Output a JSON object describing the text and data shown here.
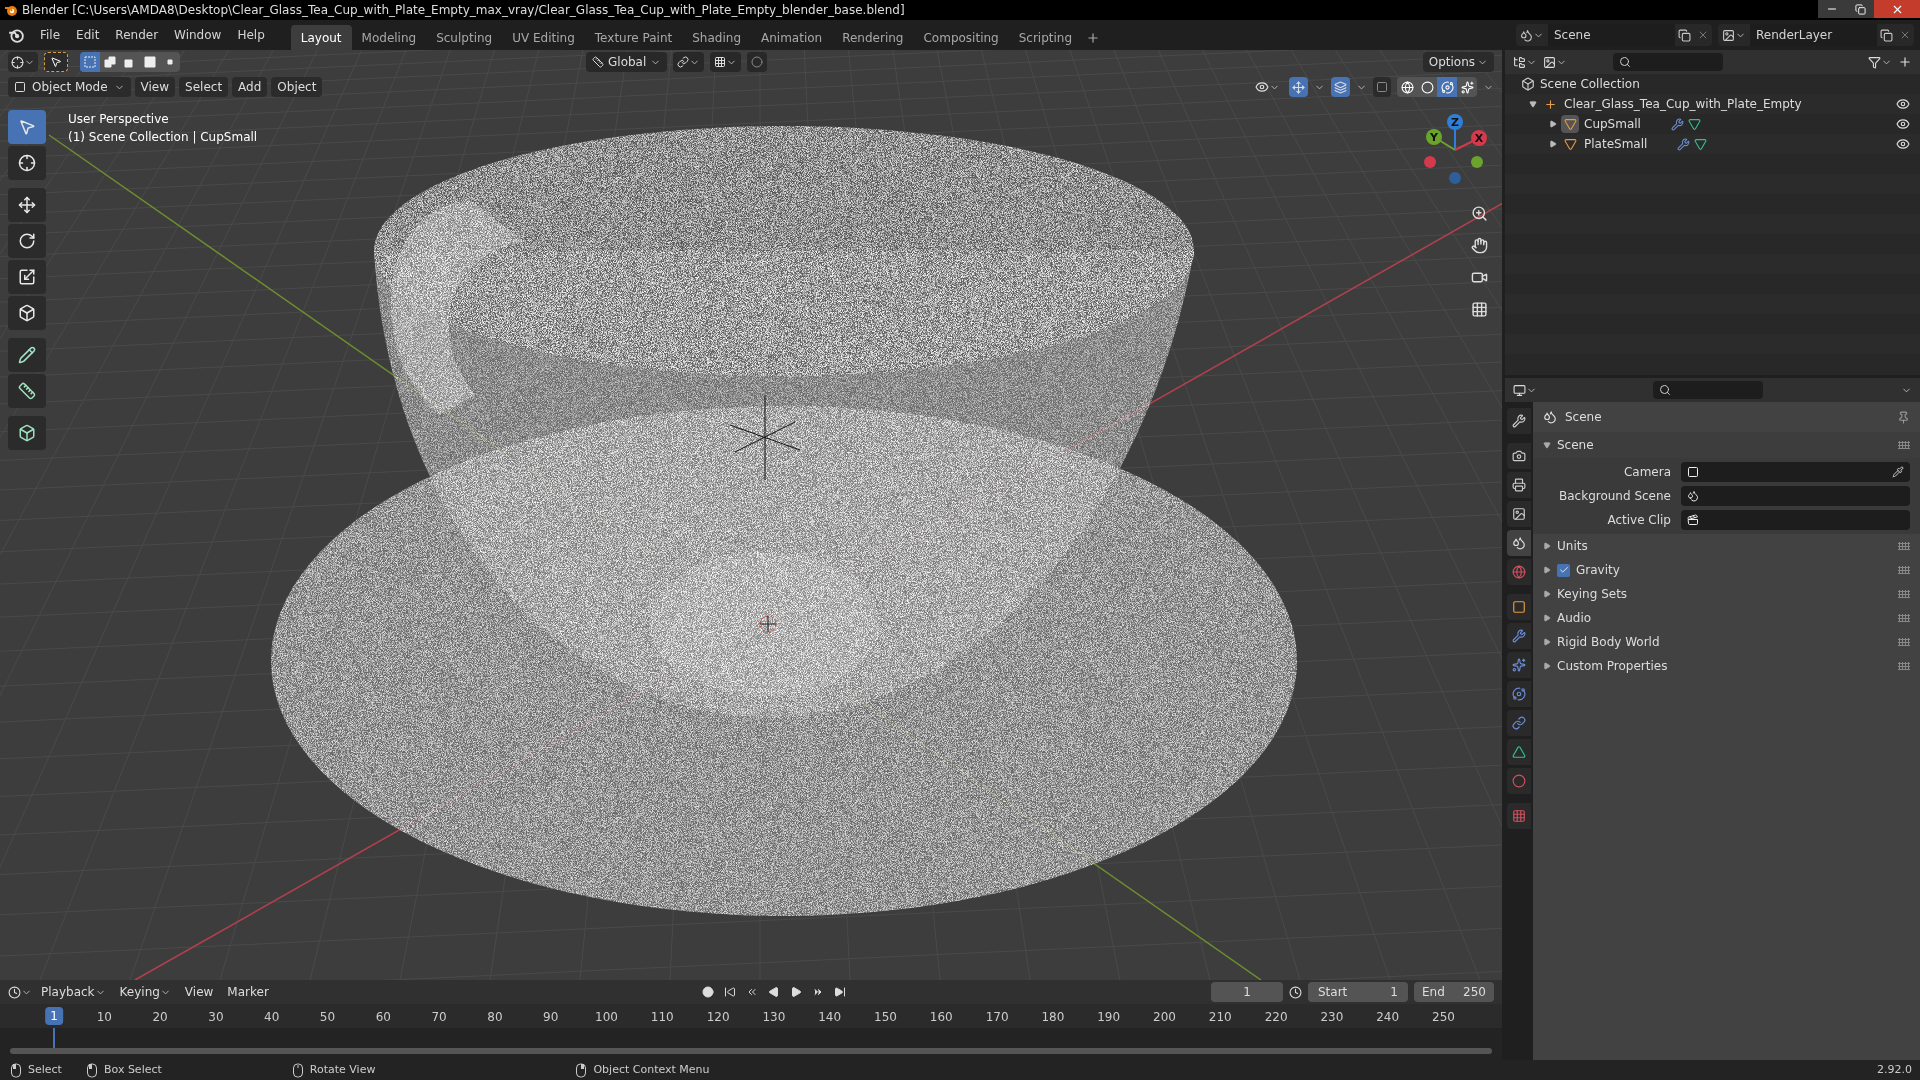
{
  "window": {
    "title": "Blender [C:\\Users\\AMDA8\\Desktop\\Clear_Glass_Tea_Cup_with_Plate_Empty_max_vray/Clear_Glass_Tea_Cup_with_Plate_Empty_blender_base.blend]"
  },
  "menu": [
    "File",
    "Edit",
    "Render",
    "Window",
    "Help"
  ],
  "workspaces": [
    {
      "label": "Layout",
      "selected": true
    },
    {
      "label": "Modeling",
      "selected": false
    },
    {
      "label": "Sculpting",
      "selected": false
    },
    {
      "label": "UV Editing",
      "selected": false
    },
    {
      "label": "Texture Paint",
      "selected": false
    },
    {
      "label": "Shading",
      "selected": false
    },
    {
      "label": "Animation",
      "selected": false
    },
    {
      "label": "Rendering",
      "selected": false
    },
    {
      "label": "Compositing",
      "selected": false
    },
    {
      "label": "Scripting",
      "selected": false
    }
  ],
  "scene_selector": {
    "value": "Scene"
  },
  "view_layer_selector": {
    "value": "RenderLayer"
  },
  "tool_header": {
    "select_modes": [
      {
        "kind": "set",
        "selected": true
      },
      {
        "kind": "extend",
        "selected": false
      },
      {
        "kind": "subtract",
        "selected": false
      },
      {
        "kind": "invert",
        "selected": false
      },
      {
        "kind": "intersect",
        "selected": false
      }
    ],
    "orientation": "Global",
    "options": "Options"
  },
  "viewport_header": {
    "mode": "Object Mode",
    "menus": [
      "View",
      "Select",
      "Add",
      "Object"
    ],
    "shading": [
      {
        "kind": "wireframe",
        "selected": false
      },
      {
        "kind": "solid",
        "selected": false
      },
      {
        "kind": "material",
        "selected": true
      },
      {
        "kind": "rendered",
        "selected": false
      }
    ]
  },
  "viewport": {
    "info": [
      "User Perspective",
      "(1) Scene Collection | CupSmall"
    ],
    "gizmo_axes": [
      {
        "label": "Z",
        "color": "#2f7fd8"
      },
      {
        "label": "Y",
        "color": "#6ba42a"
      },
      {
        "label": "X",
        "color": "#d5394c"
      }
    ]
  },
  "toolbar": [
    {
      "kind": "select",
      "selected": true
    },
    {
      "kind": "cursor",
      "selected": false
    },
    {
      "kind": "move",
      "selected": false
    },
    {
      "kind": "rotate",
      "selected": false
    },
    {
      "kind": "scale",
      "selected": false
    },
    {
      "kind": "transform",
      "selected": false
    },
    {
      "kind": "annotate",
      "selected": false
    },
    {
      "kind": "measure",
      "selected": false
    },
    {
      "kind": "add-cube",
      "selected": false
    }
  ],
  "outliner": {
    "root": "Scene Collection",
    "items": [
      {
        "label": "Clear_Glass_Tea_Cup_with_Plate_Empty",
        "kind": "empty",
        "expanded": true,
        "children": [
          {
            "label": "CupSmall",
            "kind": "mesh",
            "expanded": false,
            "active": true
          },
          {
            "label": "PlateSmall",
            "kind": "mesh",
            "expanded": false,
            "active": false
          }
        ]
      }
    ]
  },
  "properties": {
    "tabs": [
      {
        "kind": "tool",
        "selected": false
      },
      {
        "kind": "render",
        "selected": false
      },
      {
        "kind": "output",
        "selected": false
      },
      {
        "kind": "view-layer",
        "selected": false
      },
      {
        "kind": "scene",
        "selected": true
      },
      {
        "kind": "world",
        "selected": false
      },
      {
        "kind": "object",
        "selected": false
      },
      {
        "kind": "modifiers",
        "selected": false
      },
      {
        "kind": "particles",
        "selected": false
      },
      {
        "kind": "physics",
        "selected": false
      },
      {
        "kind": "constraints",
        "selected": false
      },
      {
        "kind": "data",
        "selected": false
      },
      {
        "kind": "material",
        "selected": false
      },
      {
        "kind": "texture",
        "selected": false
      }
    ],
    "context": "Scene",
    "panel": {
      "title": "Scene",
      "expanded": true,
      "fields": [
        {
          "label": "Camera",
          "kind": "camera"
        },
        {
          "label": "Background Scene",
          "kind": "scene"
        },
        {
          "label": "Active Clip",
          "kind": "clip"
        }
      ]
    },
    "subpanels": [
      {
        "label": "Units",
        "expanded": false
      },
      {
        "label": "Gravity",
        "expanded": false,
        "checked": true
      },
      {
        "label": "Keying Sets",
        "expanded": false
      },
      {
        "label": "Audio",
        "expanded": false
      },
      {
        "label": "Rigid Body World",
        "expanded": false
      },
      {
        "label": "Custom Properties",
        "expanded": false
      }
    ]
  },
  "timeline": {
    "menus": [
      {
        "label": "Playback",
        "dropdown": true
      },
      {
        "label": "Keying",
        "dropdown": true
      },
      {
        "label": "View",
        "dropdown": false
      },
      {
        "label": "Marker",
        "dropdown": false
      }
    ],
    "current_frame": "1",
    "start": {
      "label": "Start",
      "value": "1"
    },
    "end": {
      "label": "End",
      "value": "250"
    },
    "playhead": "1",
    "ticks": [
      "10",
      "20",
      "30",
      "40",
      "50",
      "60",
      "70",
      "80",
      "90",
      "100",
      "110",
      "120",
      "130",
      "140",
      "150",
      "160",
      "170",
      "180",
      "190",
      "200",
      "210",
      "220",
      "230",
      "240",
      "250"
    ]
  },
  "status_bar": {
    "hints": [
      {
        "kind": "left",
        "label": "Select"
      },
      {
        "kind": "drag",
        "label": "Box Select"
      },
      {
        "kind": "middle",
        "label": "Rotate View"
      },
      {
        "kind": "right",
        "label": "Object Context Menu"
      }
    ],
    "version": "2.92.0"
  }
}
